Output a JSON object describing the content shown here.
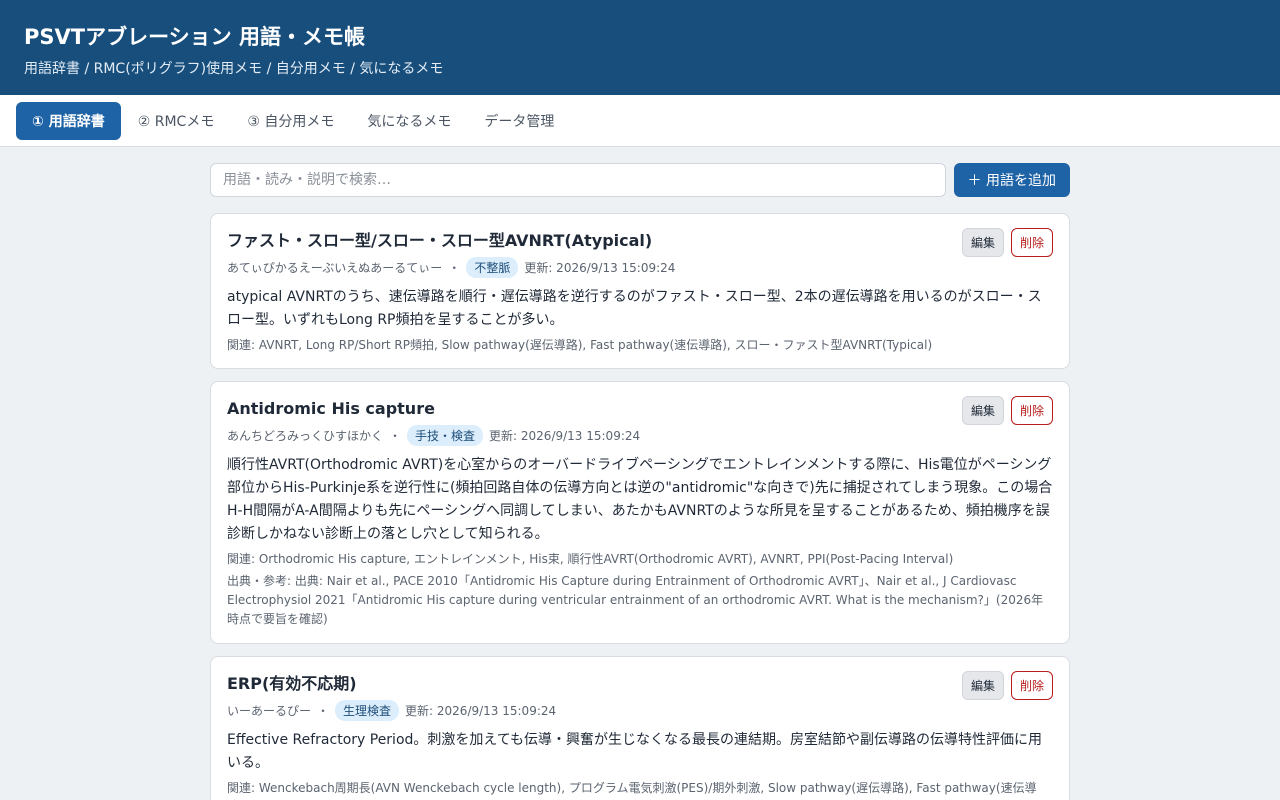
{
  "header": {
    "title": "PSVTアブレーション 用語・メモ帳",
    "subtitle": "用語辞書 / RMC(ポリグラフ)使用メモ / 自分用メモ / 気になるメモ"
  },
  "tabs": [
    {
      "label": "① 用語辞書",
      "active": true
    },
    {
      "label": "② RMCメモ",
      "active": false
    },
    {
      "label": "③ 自分用メモ",
      "active": false
    },
    {
      "label": "気になるメモ",
      "active": false
    },
    {
      "label": "データ管理",
      "active": false
    }
  ],
  "search": {
    "placeholder": "用語・読み・説明で検索…",
    "value": ""
  },
  "add_button": "＋ 用語を追加",
  "edit_label": "編集",
  "delete_label": "削除",
  "cards": [
    {
      "title": "ファスト・スロー型/スロー・スロー型AVNRT(Atypical)",
      "reading": "あてぃぴかるえーぶいえぬあーるてぃー",
      "category": "不整脈",
      "updated": "更新: 2026/9/13 15:09:24",
      "description": "atypical AVNRTのうち、速伝導路を順行・遅伝導路を逆行するのがファスト・スロー型、2本の遅伝導路を用いるのがスロー・スロー型。いずれもLong RP頻拍を呈することが多い。",
      "related": "関連: AVNRT, Long RP/Short RP頻拍, Slow pathway(遅伝導路), Fast pathway(速伝導路), スロー・ファスト型AVNRT(Typical)",
      "source": ""
    },
    {
      "title": "Antidromic His capture",
      "reading": "あんちどろみっくひすほかく",
      "category": "手技・検査",
      "updated": "更新: 2026/9/13 15:09:24",
      "description": "順行性AVRT(Orthodromic AVRT)を心室からのオーバードライブペーシングでエントレインメントする際に、His電位がペーシング部位からHis-Purkinje系を逆行性に(頻拍回路自体の伝導方向とは逆の\"antidromic\"な向きで)先に捕捉されてしまう現象。この場合H-H間隔がA-A間隔よりも先にペーシングへ同調してしまい、あたかもAVNRTのような所見を呈することがあるため、頻拍機序を誤診断しかねない診断上の落とし穴として知られる。",
      "related": "関連: Orthodromic His capture, エントレインメント, His束, 順行性AVRT(Orthodromic AVRT), AVNRT, PPI(Post-Pacing Interval)",
      "source": "出典・参考: 出典: Nair et al., PACE 2010「Antidromic His Capture during Entrainment of Orthodromic AVRT」、Nair et al., J Cardiovasc Electrophysiol 2021「Antidromic His capture during ventricular entrainment of an orthodromic AVRT. What is the mechanism?」(2026年時点で要旨を確認)"
    },
    {
      "title": "ERP(有効不応期)",
      "reading": "いーあーるぴー",
      "category": "生理検査",
      "updated": "更新: 2026/9/13 15:09:24",
      "description": "Effective Refractory Period。刺激を加えても伝導・興奮が生じなくなる最長の連結期。房室結節や副伝導路の伝導特性評価に用いる。",
      "related": "関連: Wenckebach周期長(AVN Wenckebach cycle length), プログラム電気刺激(PES)/期外刺激, Slow pathway(遅伝導路), Fast pathway(速伝導路)",
      "source": ""
    }
  ]
}
